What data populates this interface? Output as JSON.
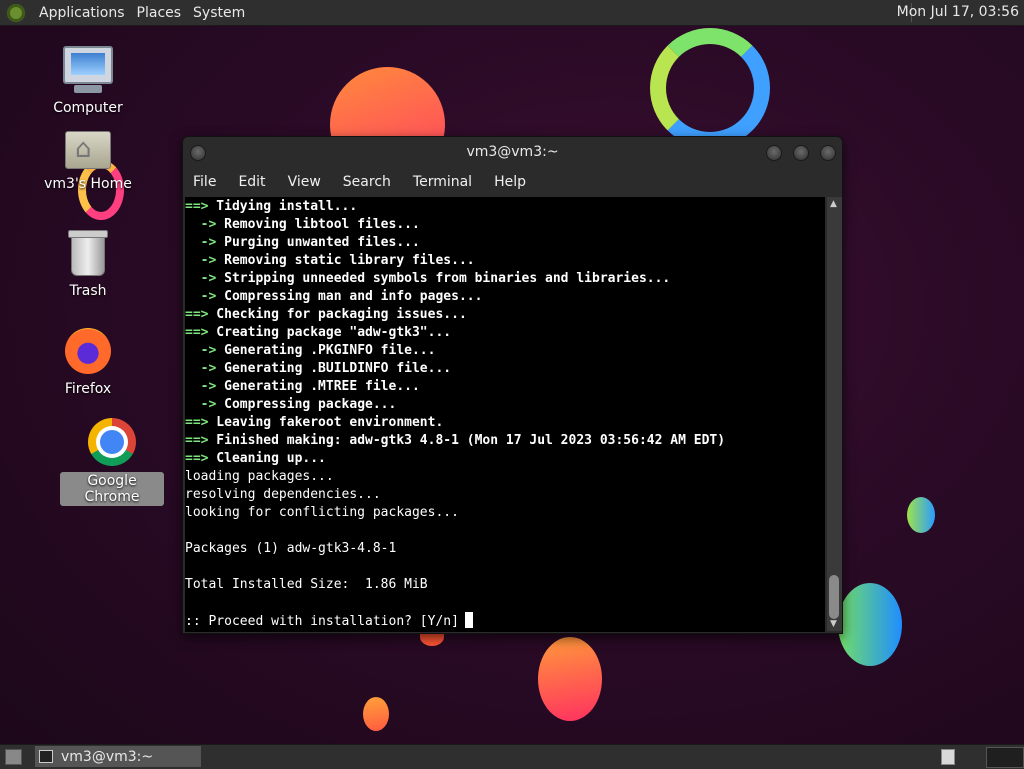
{
  "top_panel": {
    "menus": [
      "Applications",
      "Places",
      "System"
    ],
    "clock": "Mon Jul 17, 03:56"
  },
  "desktop_icons": [
    {
      "label": "Computer",
      "icon": "computer-icon"
    },
    {
      "label": "vm3's Home",
      "icon": "home-folder-icon"
    },
    {
      "label": "Trash",
      "icon": "trash-icon"
    },
    {
      "label": "Firefox",
      "icon": "firefox-icon"
    },
    {
      "label": "Google Chrome",
      "icon": "chrome-icon"
    }
  ],
  "terminal": {
    "title": "vm3@vm3:~",
    "menu": [
      "File",
      "Edit",
      "View",
      "Search",
      "Terminal",
      "Help"
    ],
    "lines": [
      {
        "prefix": "==>",
        "text": " Tidying install...",
        "style": "bold"
      },
      {
        "prefix": "  ->",
        "text": " Removing libtool files...",
        "style": "bold"
      },
      {
        "prefix": "  ->",
        "text": " Purging unwanted files...",
        "style": "bold"
      },
      {
        "prefix": "  ->",
        "text": " Removing static library files...",
        "style": "bold"
      },
      {
        "prefix": "  ->",
        "text": " Stripping unneeded symbols from binaries and libraries...",
        "style": "bold"
      },
      {
        "prefix": "  ->",
        "text": " Compressing man and info pages...",
        "style": "bold"
      },
      {
        "prefix": "==>",
        "text": " Checking for packaging issues...",
        "style": "bold"
      },
      {
        "prefix": "==>",
        "text": " Creating package \"adw-gtk3\"...",
        "style": "bold"
      },
      {
        "prefix": "  ->",
        "text": " Generating .PKGINFO file...",
        "style": "bold"
      },
      {
        "prefix": "  ->",
        "text": " Generating .BUILDINFO file...",
        "style": "bold"
      },
      {
        "prefix": "  ->",
        "text": " Generating .MTREE file...",
        "style": "bold"
      },
      {
        "prefix": "  ->",
        "text": " Compressing package...",
        "style": "bold"
      },
      {
        "prefix": "==>",
        "text": " Leaving fakeroot environment.",
        "style": "bold"
      },
      {
        "prefix": "==>",
        "text": " Finished making: adw-gtk3 4.8-1 (Mon 17 Jul 2023 03:56:42 AM EDT)",
        "style": "bold"
      },
      {
        "prefix": "==>",
        "text": " Cleaning up...",
        "style": "bold"
      },
      {
        "prefix": "",
        "text": "loading packages...",
        "style": "plain"
      },
      {
        "prefix": "",
        "text": "resolving dependencies...",
        "style": "plain"
      },
      {
        "prefix": "",
        "text": "looking for conflicting packages...",
        "style": "plain"
      },
      {
        "prefix": "",
        "text": "",
        "style": "plain"
      },
      {
        "prefix": "",
        "text": "Packages (1) adw-gtk3-4.8-1",
        "style": "plain"
      },
      {
        "prefix": "",
        "text": "",
        "style": "plain"
      },
      {
        "prefix": "",
        "text": "Total Installed Size:  1.86 MiB",
        "style": "plain"
      },
      {
        "prefix": "",
        "text": "",
        "style": "plain"
      },
      {
        "prefix": "",
        "text": ":: Proceed with installation? [Y/n]",
        "style": "prompt"
      }
    ]
  },
  "bottom_panel": {
    "task_label": "vm3@vm3:~"
  }
}
